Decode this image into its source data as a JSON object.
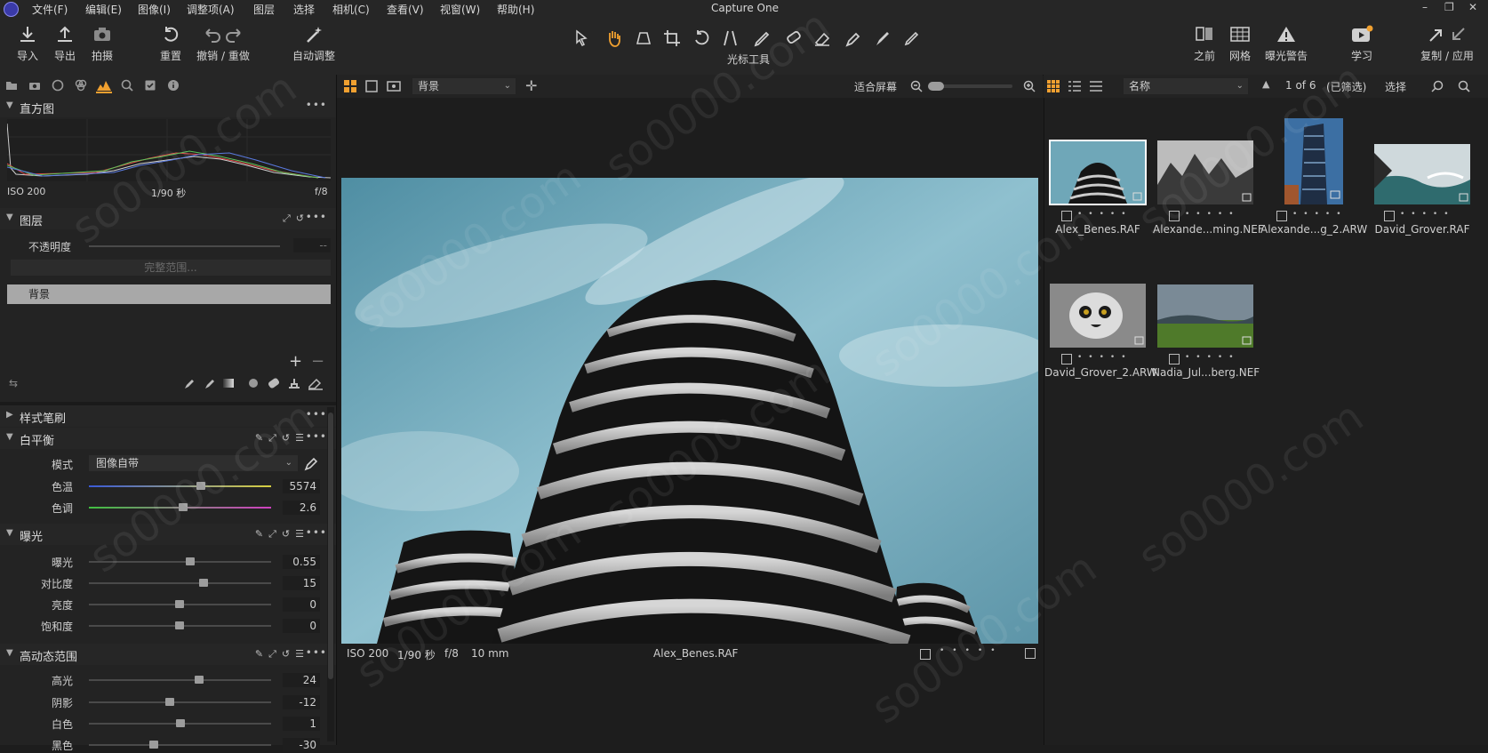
{
  "menubar": {
    "app_logo": "capture-one-logo",
    "items": [
      "文件(F)",
      "编辑(E)",
      "图像(I)",
      "调整项(A)",
      "图层",
      "选择",
      "相机(C)",
      "查看(V)",
      "视窗(W)",
      "帮助(H)"
    ],
    "title": "Capture One",
    "window_controls": [
      "–",
      "❐",
      "✕"
    ]
  },
  "toolbar": {
    "left_buttons": [
      {
        "label": "导入",
        "icon": "import-icon"
      },
      {
        "label": "导出",
        "icon": "export-icon"
      },
      {
        "label": "拍摄",
        "icon": "camera-icon"
      },
      {
        "label": "重置",
        "icon": "reset-icon"
      },
      {
        "label": "撤销 / 重做",
        "icon": "undo-redo-icon"
      },
      {
        "label": "自动调整",
        "icon": "auto-adjust-icon"
      }
    ],
    "cursor_tools_label": "光标工具",
    "right_buttons": [
      {
        "label": "之前",
        "icon": "before-icon"
      },
      {
        "label": "网格",
        "icon": "grid-icon"
      },
      {
        "label": "曝光警告",
        "icon": "exposure-warning-icon"
      },
      {
        "label": "学习",
        "icon": "learn-icon"
      },
      {
        "label": "复制 / 应用",
        "icon": "copy-apply-icon"
      }
    ]
  },
  "histogram": {
    "title": "直方图",
    "iso": "ISO 200",
    "shutter": "1/90 秒",
    "aperture": "f/8"
  },
  "layers": {
    "title": "图层",
    "opacity_label": "不透明度",
    "opacity_value": "--",
    "fill_range": "完整范围...",
    "background_layer": "背景"
  },
  "style_brush": {
    "title": "样式笔刷"
  },
  "white_balance": {
    "title": "白平衡",
    "mode_label": "模式",
    "mode_value": "图像自带",
    "temp_label": "色温",
    "temp_value": "5574",
    "tint_label": "色调",
    "tint_value": "2.6"
  },
  "exposure": {
    "title": "曝光",
    "rows": [
      {
        "label": "曝光",
        "value": "0.55"
      },
      {
        "label": "对比度",
        "value": "15"
      },
      {
        "label": "亮度",
        "value": "0"
      },
      {
        "label": "饱和度",
        "value": "0"
      }
    ]
  },
  "hdr": {
    "title": "高动态范围",
    "rows": [
      {
        "label": "高光",
        "value": "24"
      },
      {
        "label": "阴影",
        "value": "-12"
      },
      {
        "label": "白色",
        "value": "1"
      },
      {
        "label": "黑色",
        "value": "-30"
      }
    ]
  },
  "viewer": {
    "layer_select": "背景",
    "fit_label": "适合屏幕",
    "iso": "ISO 200",
    "shutter": "1/90 秒",
    "aperture": "f/8",
    "focal": "10 mm",
    "filename": "Alex_Benes.RAF"
  },
  "browser": {
    "sort_select": "名称",
    "count": "1 of 6",
    "filtered": "(已筛选)",
    "select_label": "选择",
    "thumbnails": [
      {
        "name": "Alex_Benes.RAF"
      },
      {
        "name": "Alexande...ming.NEF"
      },
      {
        "name": "Alexande...g_2.ARW"
      },
      {
        "name": "David_Grover.RAF"
      },
      {
        "name": "David_Grover_2.ARW"
      },
      {
        "name": "Nadia_Jul...berg.NEF"
      }
    ]
  },
  "watermark": "so0000.com",
  "colors": {
    "accent": "#f0a030",
    "panel": "#232323",
    "selected_layer": "#a8a8a8"
  }
}
